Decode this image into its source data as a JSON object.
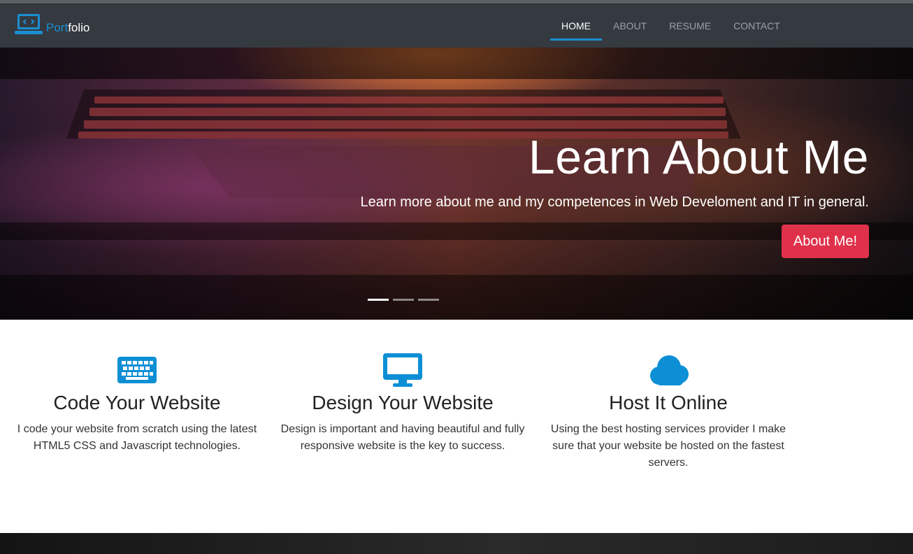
{
  "brand": {
    "part1": "Port",
    "part2": "folio",
    "icon": "laptop-code-icon"
  },
  "nav": [
    {
      "label": "HOME",
      "active": true
    },
    {
      "label": "ABOUT",
      "active": false
    },
    {
      "label": "RESUME",
      "active": false
    },
    {
      "label": "CONTACT",
      "active": false
    }
  ],
  "hero": {
    "title": "Learn About Me",
    "subtitle": "Learn more about me and my competences in Web Develoment and IT in general.",
    "button_label": "About Me!",
    "slides": 3,
    "active_slide": 1
  },
  "features": [
    {
      "icon": "keyboard-icon",
      "title": "Code Your Website",
      "text": "I code your website from scratch using the latest HTML5 CSS and Javascript technologies."
    },
    {
      "icon": "desktop-icon",
      "title": "Design Your Website",
      "text": "Design is important and having beautiful and fully responsive website is the key to success."
    },
    {
      "icon": "cloud-icon",
      "title": "Host It Online",
      "text": "Using the best hosting services provider I make sure that your website be hosted on the fastest servers."
    }
  ],
  "colors": {
    "navbar": "#343a40",
    "accent": "#1a8fd1",
    "button": "#e0314a",
    "icon": "#0d8fd6"
  }
}
